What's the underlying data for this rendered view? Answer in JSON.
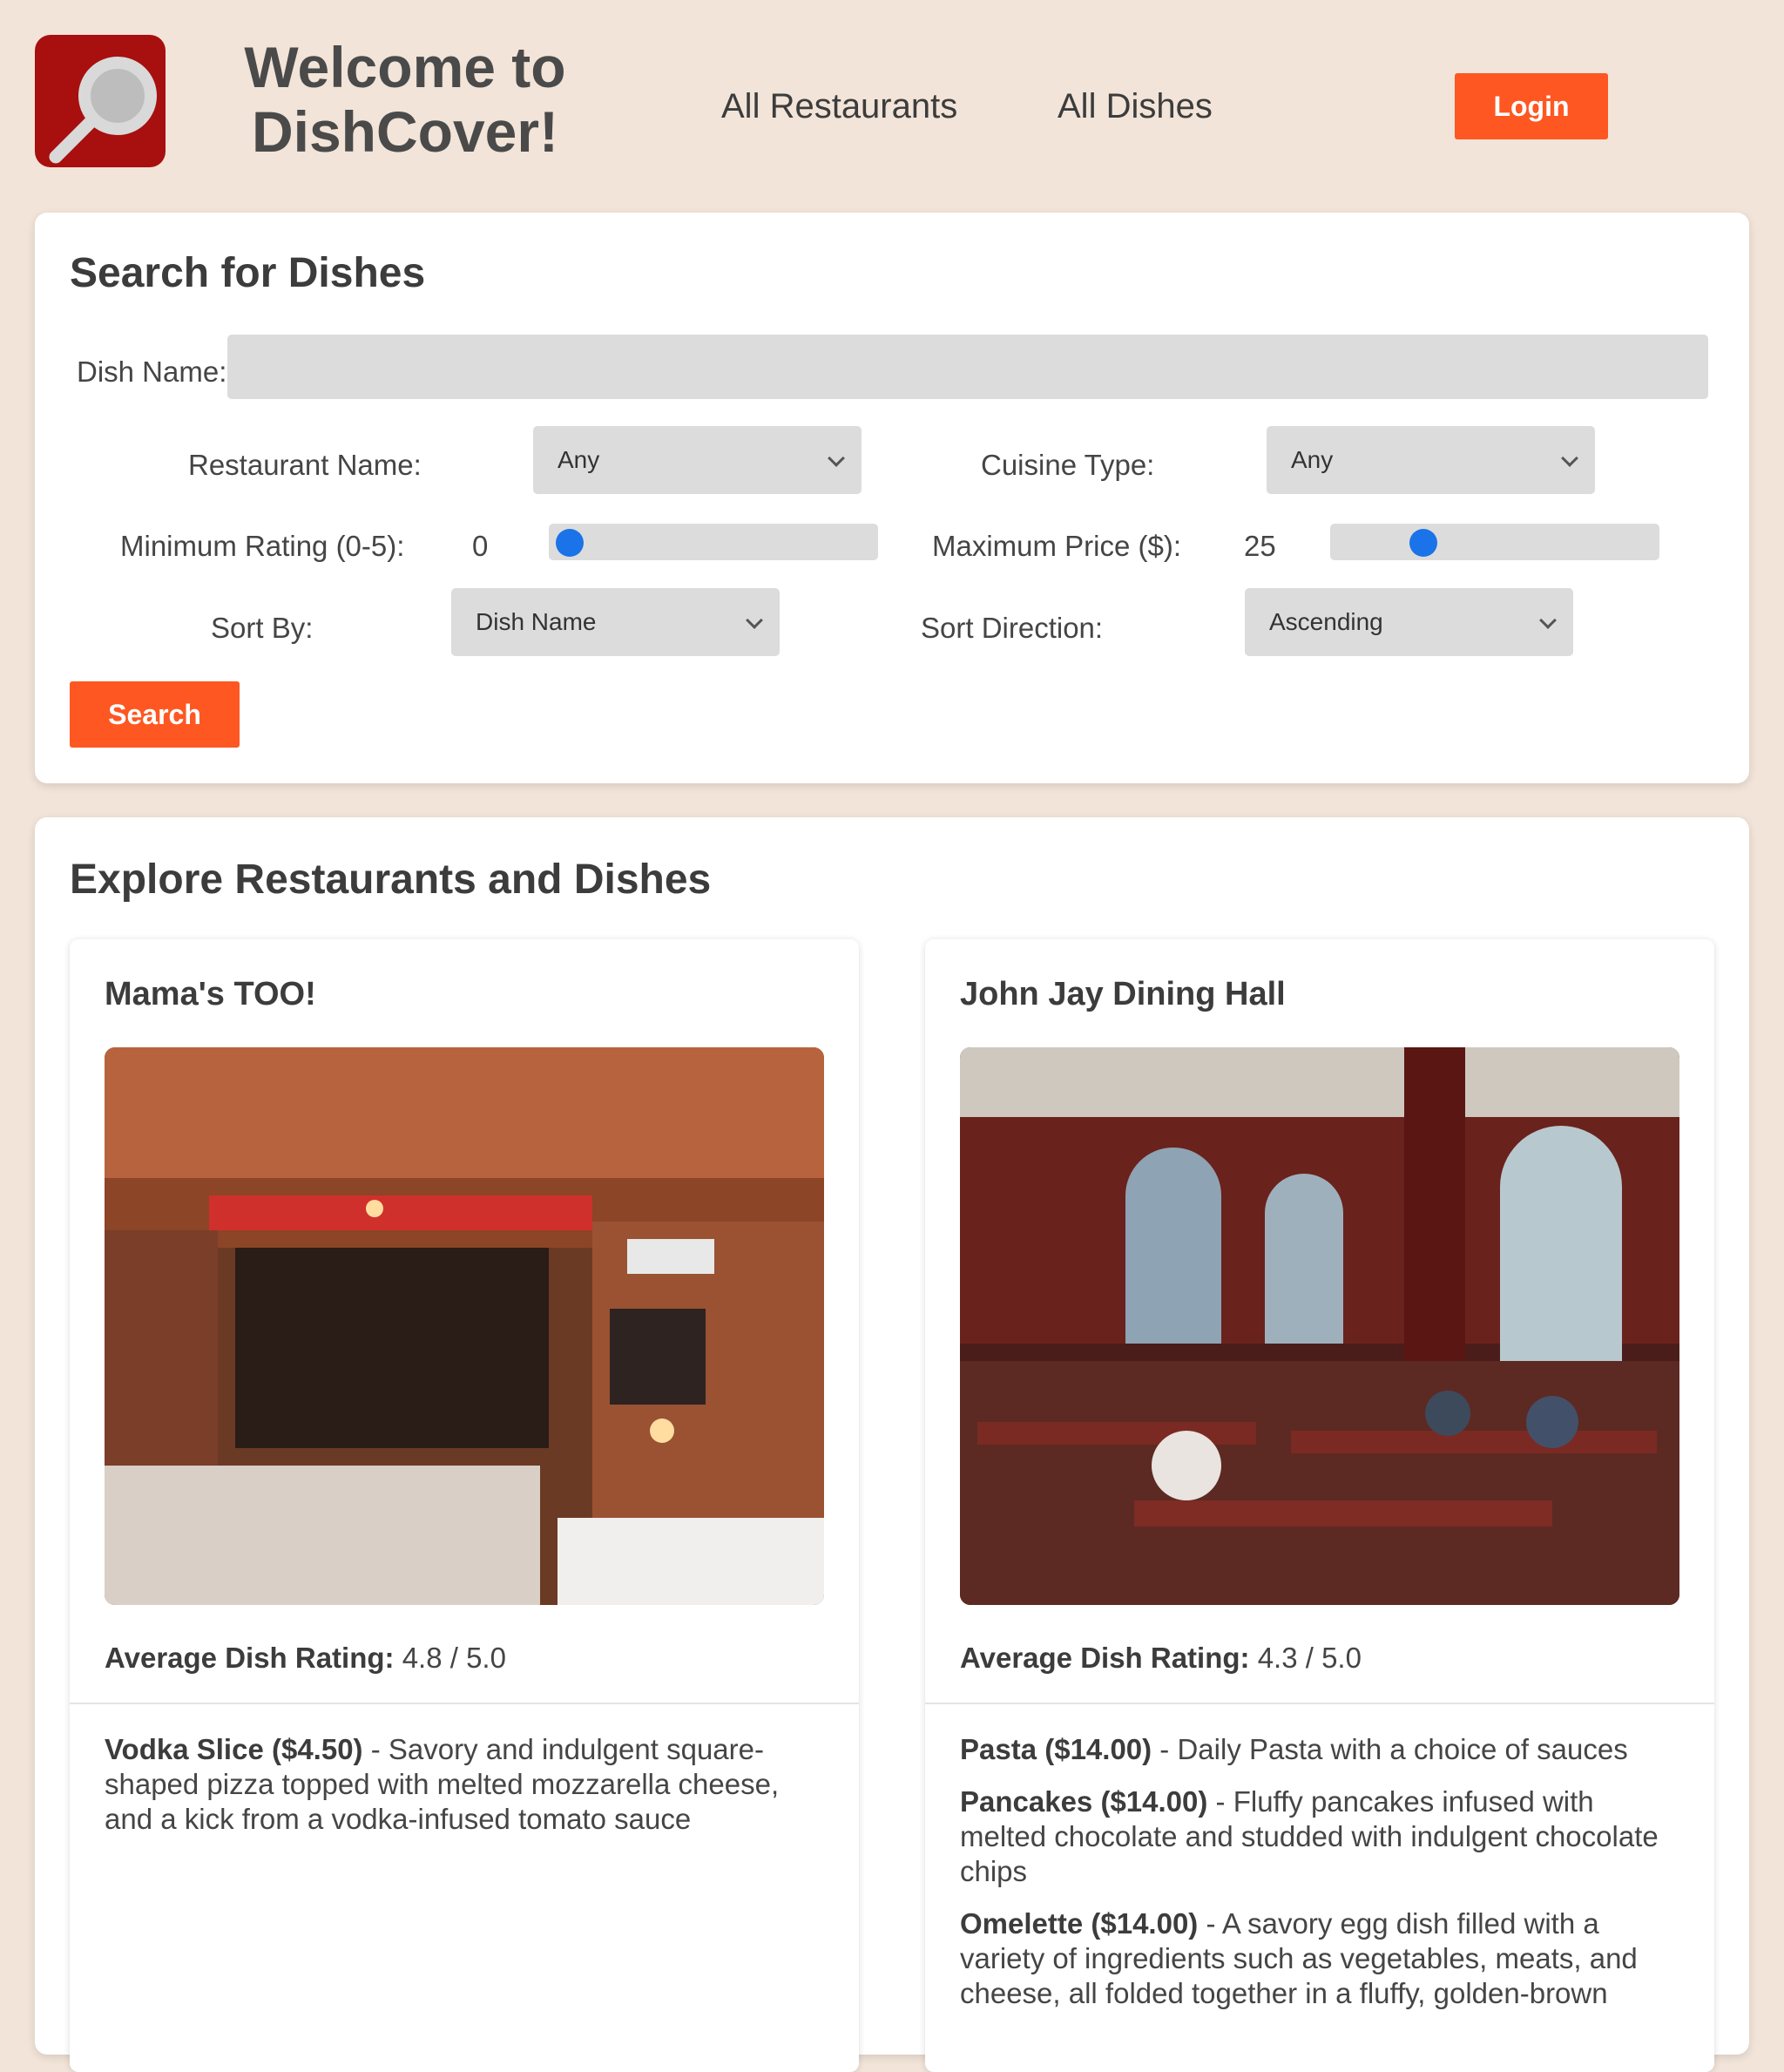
{
  "header": {
    "title": "Welcome to DishCover!",
    "logo_icon": "magnifier-icon",
    "nav": {
      "restaurants": "All Restaurants",
      "dishes": "All Dishes"
    },
    "login_label": "Login"
  },
  "search": {
    "title": "Search for Dishes",
    "dish_name_label": "Dish Name:",
    "dish_name_value": "",
    "restaurant_label": "Restaurant Name:",
    "restaurant_value": "Any",
    "cuisine_label": "Cuisine Type:",
    "cuisine_value": "Any",
    "min_rating_label": "Minimum Rating (0-5):",
    "min_rating_value": "0",
    "min_rating_level": 0.0,
    "max_price_label": "Maximum Price ($):",
    "max_price_value": "25",
    "max_price_level": 0.25,
    "sort_by_label": "Sort By:",
    "sort_by_value": "Dish Name",
    "sort_dir_label": "Sort Direction:",
    "sort_dir_value": "Ascending",
    "button_label": "Search"
  },
  "explore": {
    "title": "Explore Restaurants and Dishes",
    "rating_label": "Average Dish Rating:",
    "restaurants": [
      {
        "name": "Mama's TOO!",
        "rating": "4.8 / 5.0",
        "dishes": [
          {
            "name": "Vodka Slice ($4.50)",
            "desc": " - Savory and indulgent square-shaped pizza topped with melted mozzarella cheese, and a kick from a vodka-infused tomato sauce"
          }
        ]
      },
      {
        "name": "John Jay Dining Hall",
        "rating": "4.3 / 5.0",
        "dishes": [
          {
            "name": "Pasta ($14.00)",
            "desc": " - Daily Pasta with a choice of sauces"
          },
          {
            "name": "Pancakes ($14.00)",
            "desc": " - Fluffy pancakes infused with melted chocolate and studded with indulgent chocolate chips"
          },
          {
            "name": "Omelette ($14.00)",
            "desc": " - A savory egg dish filled with a variety of ingredients such as vegetables, meats, and cheese, all folded together in a fluffy, golden-brown"
          }
        ]
      }
    ]
  },
  "colors": {
    "background": "#f2e4d8",
    "accent": "#fe5722",
    "logo": "#a80f0f",
    "slider_thumb": "#1a73e8"
  }
}
